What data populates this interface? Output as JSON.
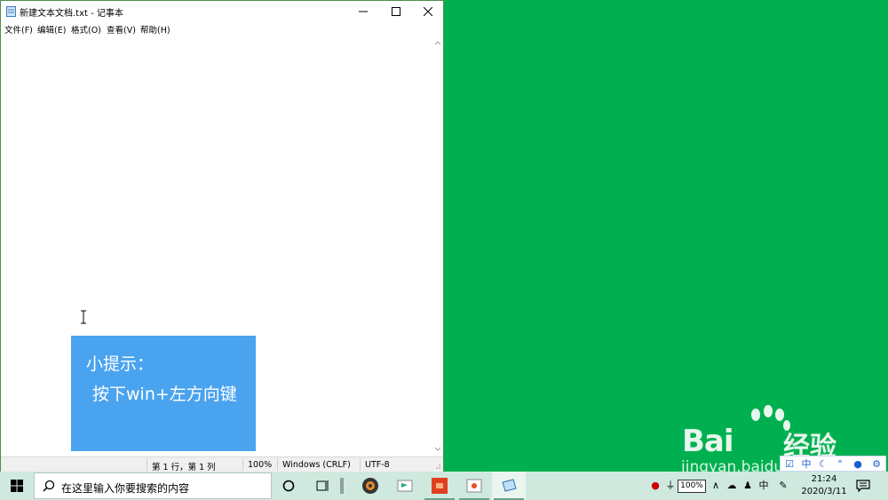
{
  "window": {
    "title": "新建文本文档.txt - 记事本",
    "minimize_icon": "minimize-icon",
    "maximize_icon": "maximize-icon",
    "close_icon": "close-icon"
  },
  "menu": [
    {
      "label": "文件(F)"
    },
    {
      "label": "编辑(E)"
    },
    {
      "label": "格式(O)"
    },
    {
      "label": "查看(V)"
    },
    {
      "label": "帮助(H)"
    }
  ],
  "editor": {
    "content": ""
  },
  "status": {
    "position": "第 1 行，第 1 列",
    "zoom": "100%",
    "line_ending": "Windows (CRLF)",
    "encoding": "UTF-8"
  },
  "tip": {
    "title": "小提示：",
    "body": "按下win+左方向键"
  },
  "watermark": {
    "brand": "Bai",
    "brand2": "经验",
    "url": "jingyan.baidu.com"
  },
  "ime": [
    "中"
  ],
  "taskbar": {
    "search_placeholder": "在这里输入你要搜索的内容",
    "battery": "100%",
    "input_mode": "中",
    "time": "21:24",
    "date": "2020/3/11"
  },
  "colors": {
    "desktop": "#00b050",
    "tip_bg": "#4aa3ee",
    "taskbar": "#cfe9df"
  }
}
